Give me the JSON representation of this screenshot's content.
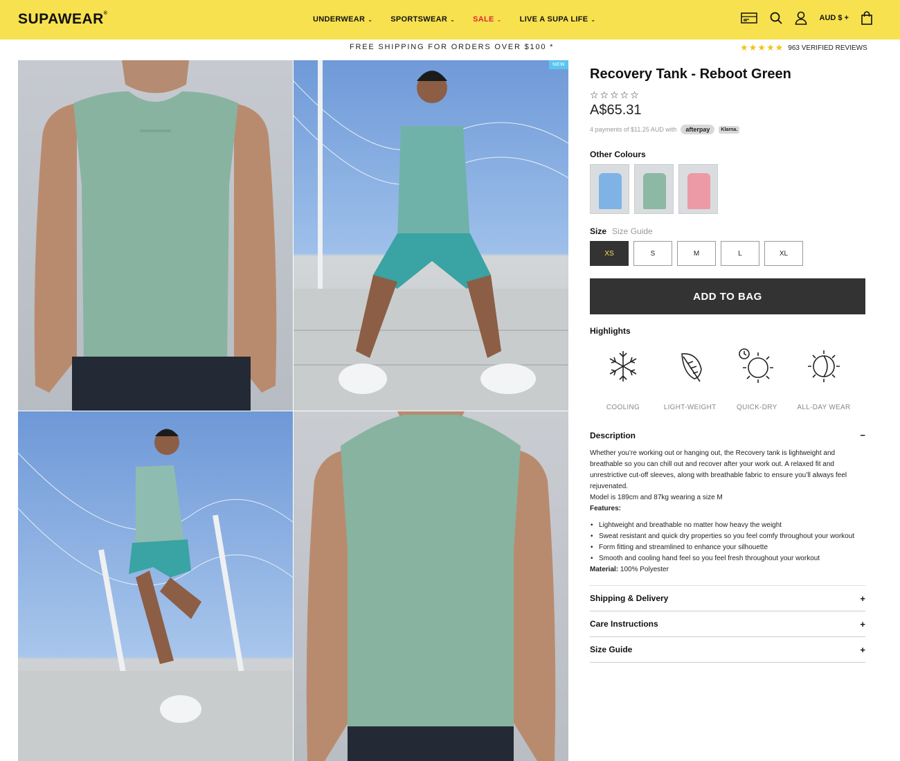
{
  "header": {
    "logo": "SUPAWEAR",
    "logo_mark": "®",
    "nav": [
      {
        "label": "UNDERWEAR",
        "chevron": "chevron-down-icon"
      },
      {
        "label": "SPORTSWEAR",
        "chevron": "chevron-down-icon"
      },
      {
        "label": "SALE",
        "chevron": "chevron-down-icon"
      },
      {
        "label": "LIVE A SUPA LIFE",
        "chevron": "chevron-down-icon"
      }
    ],
    "currency": "AUD $ +",
    "bg_color": "#f7e14f",
    "sale_color": "#e0282e"
  },
  "promo": {
    "text": "FREE SHIPPING FOR ORDERS OVER $100 *",
    "reviews_stars": "★★★★★",
    "reviews_text": "963 VERIFIED REVIEWS"
  },
  "gallery": {
    "badge": "NEW"
  },
  "product": {
    "title": "Recovery Tank - Reboot Green",
    "rating_stars": "☆☆☆☆☆",
    "price": "A$65.31",
    "payments_text": "4 payments of $11.25 AUD with",
    "afterpay": "afterpay",
    "klarna": "Klarna."
  },
  "colours": {
    "label": "Other Colours",
    "swatches": [
      {
        "name": "blue",
        "color": "#7fb3e6"
      },
      {
        "name": "green",
        "color": "#8db8a3"
      },
      {
        "name": "pink",
        "color": "#ec9aa6"
      }
    ]
  },
  "size": {
    "label": "Size",
    "guide": "Size Guide",
    "options": [
      "XS",
      "S",
      "M",
      "L",
      "XL"
    ],
    "selected": "XS"
  },
  "add_to_bag": "ADD TO BAG",
  "highlights": {
    "label": "Highlights",
    "items": [
      {
        "label": "COOLING",
        "icon": "snowflake-icon"
      },
      {
        "label": "LIGHT-WEIGHT",
        "icon": "feather-icon"
      },
      {
        "label": "QUICK-DRY",
        "icon": "sun-timer-icon"
      },
      {
        "label": "ALL-DAY WEAR",
        "icon": "half-sun-icon"
      }
    ]
  },
  "description": {
    "label": "Description",
    "toggle": "−",
    "paragraph": "Whether you’re working out or hanging out, the Recovery tank is lightweight and breathable so you can chill out and recover after your work out. A relaxed fit and unrestrictive cut-off sleeves, along with breathable fabric to ensure you’ll always feel rejuvenated.",
    "model": "Model is 189cm and 87kg wearing a size M",
    "features_title": "Features:",
    "features": [
      "Lightweight and breathable no matter how heavy the weight",
      "Sweat resistant and quick dry properties so you feel comfy throughout your workout",
      "Form fitting and streamlined to enhance your silhouette",
      "Smooth and cooling hand feel so you feel fresh throughout your workout"
    ],
    "material_label": "Material:",
    "material_value": " 100% Polyester"
  },
  "accordions": [
    {
      "label": "Shipping & Delivery",
      "toggle": "+"
    },
    {
      "label": "Care Instructions",
      "toggle": "+"
    },
    {
      "label": "Size Guide",
      "toggle": "+"
    }
  ]
}
